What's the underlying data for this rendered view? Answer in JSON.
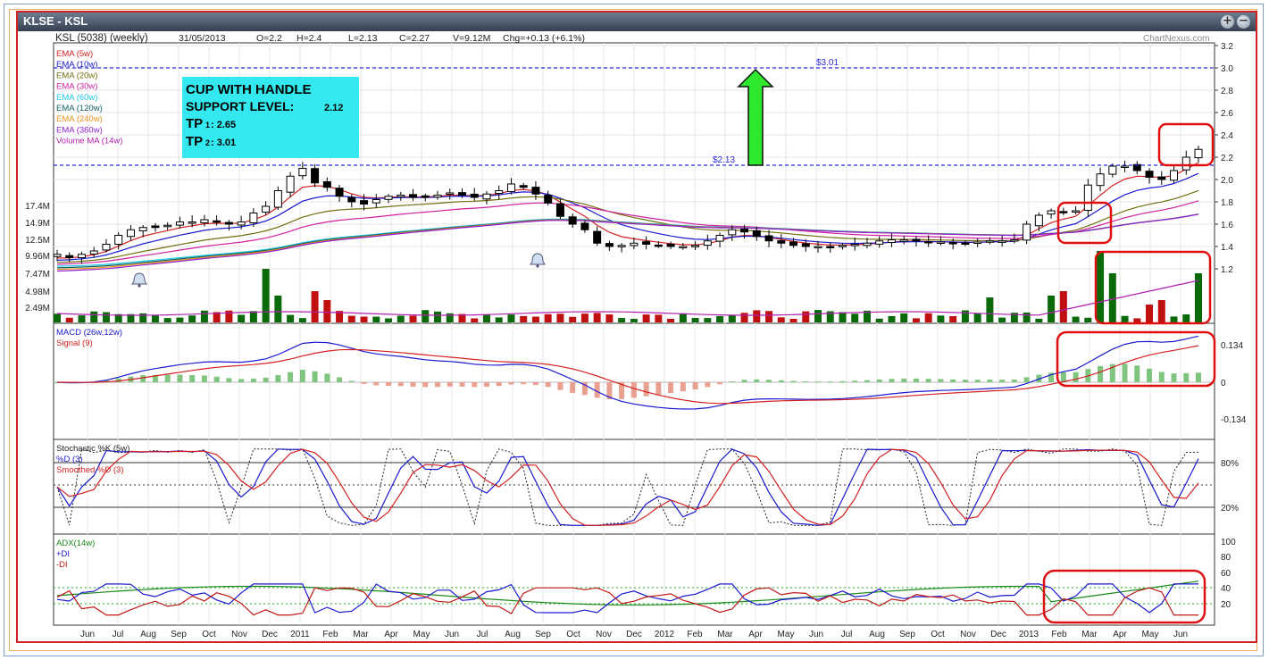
{
  "window": {
    "title": "KLSE - KSL",
    "buttons": [
      "+",
      "−"
    ]
  },
  "header": {
    "symbol": "KSL (5038) (weekly)",
    "date": "31/05/2013",
    "open": "O=2.2",
    "high": "H=2.4",
    "low": "L=2.13",
    "close": "C=2.27",
    "volume": "V=9.12M",
    "change": "Chg=+0.13 (+6.1%)",
    "watermark": "ChartNexus.com"
  },
  "annotation_box": {
    "line1": "CUP WITH HANDLE",
    "line2a": "SUPPORT LEVEL:",
    "line2b": "2.12",
    "line3a": "TP",
    "line3sub": "1",
    "line3b": ":  2.65",
    "line4a": "TP",
    "line4sub": "2",
    "line4b": ":  3.01",
    "bg": "#33e8ee"
  },
  "levels": {
    "upper_label": "$3.01",
    "lower_label": "$2.13"
  },
  "legends": {
    "price": [
      {
        "text": "EMA (5w)",
        "color": "#d42020"
      },
      {
        "text": "EMA (10w)",
        "color": "#1a1ad0"
      },
      {
        "text": "EMA (20w)",
        "color": "#707010"
      },
      {
        "text": "EMA (30w)",
        "color": "#d020a0"
      },
      {
        "text": "EMA (60w)",
        "color": "#20c8e8"
      },
      {
        "text": "EMA (120w)",
        "color": "#106060"
      },
      {
        "text": "EMA (240w)",
        "color": "#e8901a"
      },
      {
        "text": "EMA (360w)",
        "color": "#9020d0"
      },
      {
        "text": "Volume MA (14w)",
        "color": "#b020b0"
      }
    ],
    "macd": [
      {
        "text": "MACD (26w,12w)",
        "color": "#1a1ad0"
      },
      {
        "text": "Signal (9)",
        "color": "#d42020"
      }
    ],
    "stoch": [
      {
        "text": "Stochastic %K (5w)",
        "color": "#222222"
      },
      {
        "text": "%D (3)",
        "color": "#1a1ad0"
      },
      {
        "text": "Smoothed %D (3)",
        "color": "#d42020"
      }
    ],
    "adx": [
      {
        "text": "ADX(14w)",
        "color": "#1a8a1a"
      },
      {
        "text": "+DI",
        "color": "#1a1ad0"
      },
      {
        "text": "-DI",
        "color": "#c01818"
      }
    ]
  },
  "chart_data": {
    "type": "candlestick",
    "price_axis": {
      "ticks": [
        "3.2",
        "3.0",
        "2.8",
        "2.6",
        "2.4",
        "2.2",
        "2.0",
        "1.8",
        "1.6",
        "1.4",
        "1.2"
      ],
      "ylim": [
        1.2,
        3.2
      ]
    },
    "volume_axis": {
      "ticks": [
        "17.4M",
        "14.9M",
        "12.5M",
        "9.96M",
        "7.47M",
        "4.98M",
        "2.49M"
      ]
    },
    "macd_axis": {
      "ticks": [
        "0.134",
        "0",
        "-0.134"
      ]
    },
    "stoch_axis": {
      "ticks": [
        "80%",
        "20%"
      ]
    },
    "adx_axis": {
      "ticks": [
        "100",
        "80",
        "60",
        "40",
        "20"
      ]
    },
    "x_labels": [
      "Jun",
      "Jul",
      "Aug",
      "Sep",
      "Oct",
      "Nov",
      "Dec",
      "2011",
      "Feb",
      "Mar",
      "Apr",
      "May",
      "Jun",
      "Jul",
      "Aug",
      "Sep",
      "Oct",
      "Nov",
      "Dec",
      "2012",
      "Feb",
      "Mar",
      "Apr",
      "May",
      "Jun",
      "Jul",
      "Aug",
      "Sep",
      "Oct",
      "Nov",
      "Dec",
      "2013",
      "Feb",
      "Mar",
      "Apr",
      "May",
      "Jun"
    ],
    "horizontal_levels": [
      3.01,
      2.13
    ],
    "weekly_close_approx": [
      1.33,
      1.3,
      1.33,
      1.36,
      1.42,
      1.5,
      1.55,
      1.57,
      1.57,
      1.59,
      1.62,
      1.62,
      1.64,
      1.62,
      1.6,
      1.62,
      1.7,
      1.76,
      1.9,
      2.03,
      2.1,
      1.97,
      1.93,
      1.85,
      1.8,
      1.78,
      1.82,
      1.85,
      1.86,
      1.84,
      1.84,
      1.86,
      1.88,
      1.86,
      1.84,
      1.87,
      1.9,
      1.96,
      1.93,
      1.87,
      1.79,
      1.67,
      1.6,
      1.55,
      1.43,
      1.4,
      1.41,
      1.43,
      1.42,
      1.41,
      1.4,
      1.4,
      1.41,
      1.45,
      1.5,
      1.55,
      1.53,
      1.49,
      1.45,
      1.43,
      1.41,
      1.4,
      1.4,
      1.4,
      1.41,
      1.42,
      1.43,
      1.45,
      1.46,
      1.46,
      1.45,
      1.44,
      1.44,
      1.43,
      1.43,
      1.44,
      1.45,
      1.45,
      1.46,
      1.6,
      1.68,
      1.72,
      1.71,
      1.72,
      1.95,
      2.05,
      2.12,
      2.12,
      2.08,
      2.02,
      2.0,
      2.08,
      2.2,
      2.27
    ]
  }
}
